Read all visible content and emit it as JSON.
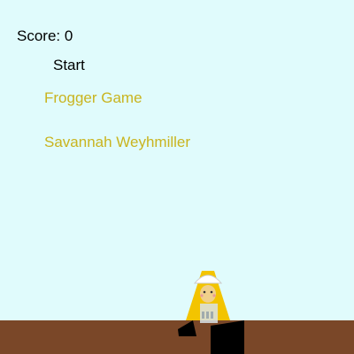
{
  "hud": {
    "score_label": "Score: 0"
  },
  "menu": {
    "start_label": "Start"
  },
  "title_screen": {
    "game_title": "Frogger Game",
    "author": "Savannah Weyhmiller"
  },
  "colors": {
    "sky": "#e0fbfc",
    "title_text": "#c9b41f",
    "ground": "#7a4728",
    "hair": "#f3c400"
  },
  "sprite": {
    "name": "player-character-sprite"
  }
}
